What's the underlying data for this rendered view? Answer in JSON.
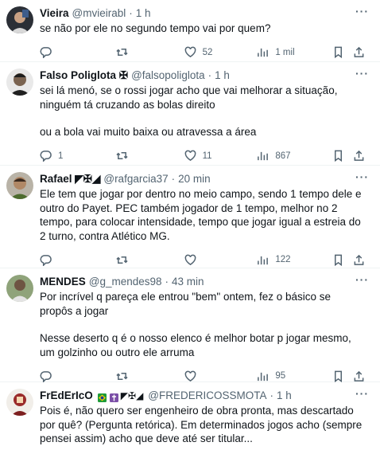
{
  "tweets": [
    {
      "name": "Vieira",
      "handle": "@mvieirabl",
      "time": "1 h",
      "lines": [
        "se não por ele no segundo tempo vai por quem?"
      ],
      "replies": "",
      "retweets": "",
      "likes": "52",
      "views": "1 mil"
    },
    {
      "name": "Falso Poliglota ✠",
      "handle": "@falsopoliglota",
      "time": "1 h",
      "lines": [
        "sei lá menó, se o rossi jogar acho que vai melhorar a situação, ninguém tá cruzando as bolas direito",
        "ou a bola vai muito baixa ou atravessa a área"
      ],
      "replies": "1",
      "retweets": "",
      "likes": "11",
      "views": "867"
    },
    {
      "name": "Rafael ◤✠◢",
      "handle": "@rafgarcia37",
      "time": "20 min",
      "lines": [
        "Ele tem que jogar por dentro no meio campo, sendo 1 tempo dele e outro do Payet. PEC também jogador de 1 tempo, melhor no 2 tempo, para colocar intensidade, tempo que jogar igual a estreia do 2 turno, contra Atlético MG."
      ],
      "replies": "",
      "retweets": "",
      "likes": "",
      "views": "122"
    },
    {
      "name": "MENDES",
      "handle": "@g_mendes98",
      "time": "43 min",
      "lines": [
        "Por incrível q pareça ele entrou \"bem\" ontem, fez o básico se propôs a jogar",
        "Nesse deserto q é o nosso elenco é melhor botar p jogar mesmo, um golzinho ou outro ele arruma"
      ],
      "replies": "",
      "retweets": "",
      "likes": "",
      "views": "95"
    },
    {
      "name": "FrEdErIcO",
      "handle": "@FREDERICOSSMOTA",
      "time": "1 h",
      "lines": [
        "Pois é, não quero ser engenheiro de obra pronta, mas descartado por quê? (Pergunta retórica). Em determinados jogos acho (sempre pensei assim) acho que deve até ser titular..."
      ],
      "replies": "",
      "retweets": "",
      "likes": "",
      "views": ""
    }
  ],
  "dot": "·",
  "more": "···",
  "badges": [
    "🇧🇷",
    "✝",
    "◤✠◢"
  ]
}
